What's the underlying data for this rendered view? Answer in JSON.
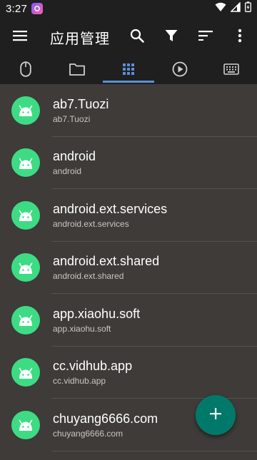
{
  "status_bar": {
    "time": "3:27",
    "icons": [
      "app-notification-icon",
      "wifi-icon",
      "signal-icon",
      "battery-charging-icon"
    ]
  },
  "app_bar": {
    "title": "应用管理",
    "actions": [
      "menu-icon",
      "search-icon",
      "filter-icon",
      "sort-icon",
      "more-vert-icon"
    ]
  },
  "tabs": [
    {
      "icon": "mouse-icon",
      "active": false
    },
    {
      "icon": "folder-icon",
      "active": false
    },
    {
      "icon": "apps-grid-icon",
      "active": true
    },
    {
      "icon": "play-circle-icon",
      "active": false
    },
    {
      "icon": "keyboard-icon",
      "active": false
    }
  ],
  "apps": [
    {
      "name": "ab7.Tuozi",
      "package": "ab7.Tuozi",
      "icon": "android-icon"
    },
    {
      "name": "android",
      "package": "android",
      "icon": "android-icon"
    },
    {
      "name": "android.ext.services",
      "package": "android.ext.services",
      "icon": "android-icon"
    },
    {
      "name": "android.ext.shared",
      "package": "android.ext.shared",
      "icon": "android-icon"
    },
    {
      "name": "app.xiaohu.soft",
      "package": "app.xiaohu.soft",
      "icon": "android-icon"
    },
    {
      "name": "cc.vidhub.app",
      "package": "cc.vidhub.app",
      "icon": "android-icon"
    },
    {
      "name": "chuyang6666.com",
      "package": "chuyang6666.com",
      "icon": "android-icon"
    }
  ],
  "fab": {
    "icon": "add-icon"
  },
  "colors": {
    "bar_background": "#1f1f1f",
    "list_background": "#3e3b38",
    "android_green": "#3ddc84",
    "tab_indicator": "#5b8fd6",
    "fab": "#00796b"
  }
}
